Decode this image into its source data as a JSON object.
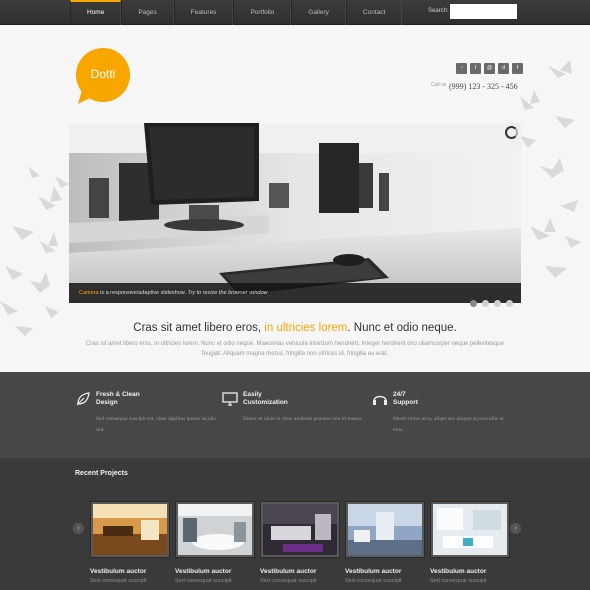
{
  "nav": {
    "items": [
      "Home",
      "Pages",
      "Features",
      "Portfolio",
      "Gallery",
      "Contact"
    ],
    "active_index": 0,
    "search_label": "Search:",
    "search_value": ""
  },
  "header": {
    "logo_text": "Dotti",
    "social_icons": [
      "rss-icon",
      "twitter-icon",
      "dribbble-icon",
      "delicious-icon",
      "facebook-icon"
    ],
    "social_glyphs": [
      "◔",
      "t",
      "@",
      "d",
      "f"
    ],
    "call_label": "Call us",
    "phone": "(999) 123 - 325 - 456"
  },
  "slider": {
    "caption_highlight": "Camera",
    "caption_text": " is a responsive/adaptive slideshow. ",
    "caption_italic": "Try to resize the browser window",
    "slides_count": 4,
    "active_slide": 0
  },
  "intro": {
    "headline_start": "Cras sit amet libero eros, ",
    "headline_highlight": "in ultricies lorem",
    "headline_end": ". Nunc et odio neque.",
    "description": "Cras sit amet libero eros, in ultricies lorem. Nunc et odio neque. Maecenas vehicula interdum hendrerit. Integer hendrerit orci ullamcorper neque pellentesque feugiat. Aliquam magna metus, fringilla non ultrices id, fringilla eu erat."
  },
  "features": [
    {
      "title_line1": "Fresh & Clean",
      "title_line2": "Design",
      "text": "Sed consequat suscipit est, vitae dapibus ipsum iaculis sed.",
      "icon": "leaf-icon"
    },
    {
      "title_line1": "Easily",
      "title_line2": "Customization",
      "text": "Donec et nisin in risus molestie posuere non id massa.",
      "icon": "monitor-icon"
    },
    {
      "title_line1": "24/7",
      "title_line2": "Support",
      "text": "Morbi tortor arcu, aliqet nec aliquet at,convallis ut eros.",
      "icon": "headset-icon"
    }
  ],
  "projects": {
    "title": "Recent Projects",
    "items": [
      {
        "title": "Vestibulum auctor",
        "subtitle": "Sed consequat suscipit"
      },
      {
        "title": "Vestibulum auctor",
        "subtitle": "Sed consequat suscipit"
      },
      {
        "title": "Vestibulum auctor",
        "subtitle": "Sed consequat suscipit"
      },
      {
        "title": "Vestibulum auctor",
        "subtitle": "Sed consequat suscipit"
      },
      {
        "title": "Vestibulum auctor",
        "subtitle": "Sed consequat suscipit"
      }
    ]
  },
  "colors": {
    "accent": "#f7a600",
    "nav_bg": "#333333",
    "features_bg": "#474747",
    "projects_bg": "#3a3a3a"
  }
}
